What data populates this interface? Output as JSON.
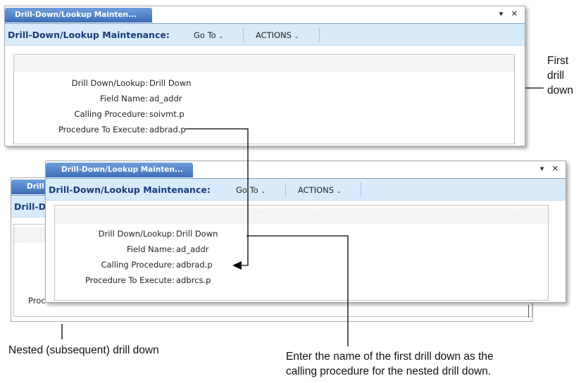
{
  "window1": {
    "tab": "Drill-Down/Lookup  Mainten...",
    "title": "Drill-Down/Lookup Maintenance:",
    "goto": "Go To",
    "actions": "ACTIONS",
    "fields": [
      {
        "label": "Drill Down/Lookup:",
        "value": "Drill Down"
      },
      {
        "label": "Field Name:",
        "value": "ad_addr"
      },
      {
        "label": "Calling Procedure:",
        "value": "soivmt.p"
      },
      {
        "label": "Procedure To Execute:",
        "value": "adbrad.p"
      }
    ]
  },
  "window_behind": {
    "tab": "Drill",
    "title": "Drill-D",
    "fragment": "Proc"
  },
  "window2": {
    "tab": "Drill-Down/Lookup  Mainten...",
    "title": "Drill-Down/Lookup Maintenance:",
    "goto": "Go To",
    "actions": "ACTIONS",
    "fields": [
      {
        "label": "Drill Down/Lookup:",
        "value": "Drill Down"
      },
      {
        "label": "Field Name:",
        "value": "ad_addr"
      },
      {
        "label": "Calling Procedure:",
        "value": "adbrad.p"
      },
      {
        "label": "Procedure To Execute:",
        "value": "adbrcs.p"
      }
    ]
  },
  "annotations": {
    "first_line1": "First",
    "first_line2": "drill",
    "first_line3": "down",
    "nested": "Nested (subsequent) drill down",
    "enter_line1": "Enter the name of the first drill down as the",
    "enter_line2": "calling procedure for the nested drill down."
  }
}
